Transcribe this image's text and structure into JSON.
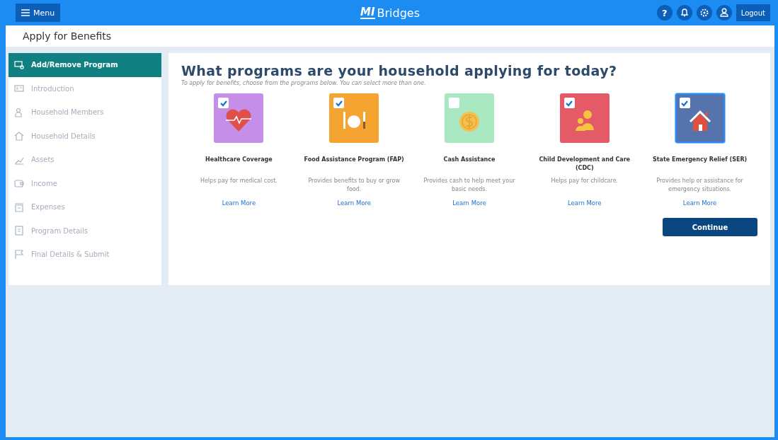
{
  "header": {
    "menu_label": "Menu",
    "logo_mark": "MI",
    "logo_text": "Bridges",
    "help": "?",
    "logout": "Logout"
  },
  "page_title": "Apply for Benefits",
  "sidebar": {
    "items": [
      {
        "label": "Add/Remove Program",
        "kind": "program",
        "selected": true
      },
      {
        "label": "Introduction",
        "kind": "intro",
        "selected": false
      },
      {
        "label": "Household Members",
        "kind": "members",
        "selected": false
      },
      {
        "label": "Household Details",
        "kind": "home",
        "selected": false
      },
      {
        "label": "Assets",
        "kind": "assets",
        "selected": false
      },
      {
        "label": "Income",
        "kind": "income",
        "selected": false
      },
      {
        "label": "Expenses",
        "kind": "expenses",
        "selected": false
      },
      {
        "label": "Program Details",
        "kind": "details",
        "selected": false
      },
      {
        "label": "Final Details & Submit",
        "kind": "flag",
        "selected": false
      }
    ]
  },
  "main": {
    "heading": "What programs are your household applying for today?",
    "subheading": "To apply for benefits, choose from the programs below. You can select more than one.",
    "programs": [
      {
        "name": "Healthcare Coverage",
        "description": "Helps pay for medical cost.",
        "link": "Learn More",
        "kind": "heart",
        "color": "#c58ee8",
        "checked": true,
        "selected": false
      },
      {
        "name": "Food Assistance Program (FAP)",
        "description": "Provides benefits to buy or grow food.",
        "link": "Learn More",
        "kind": "food",
        "color": "#f5a431",
        "checked": true,
        "selected": false
      },
      {
        "name": "Cash Assistance",
        "description": "Provides cash to help meet your basic needs.",
        "link": "Learn More",
        "kind": "cash",
        "color": "#a9e8c1",
        "checked": false,
        "selected": false
      },
      {
        "name": "Child Development and Care (CDC)",
        "description": "Helps pay for childcare.",
        "link": "Learn More",
        "kind": "child",
        "color": "#e45b67",
        "checked": true,
        "selected": false
      },
      {
        "name": "State Emergency Relief (SER)",
        "description": "Provides help or assistance for emergency situations.",
        "link": "Learn More",
        "kind": "house",
        "color": "#5574ae",
        "checked": true,
        "selected": true
      }
    ],
    "continue": "Continue"
  }
}
